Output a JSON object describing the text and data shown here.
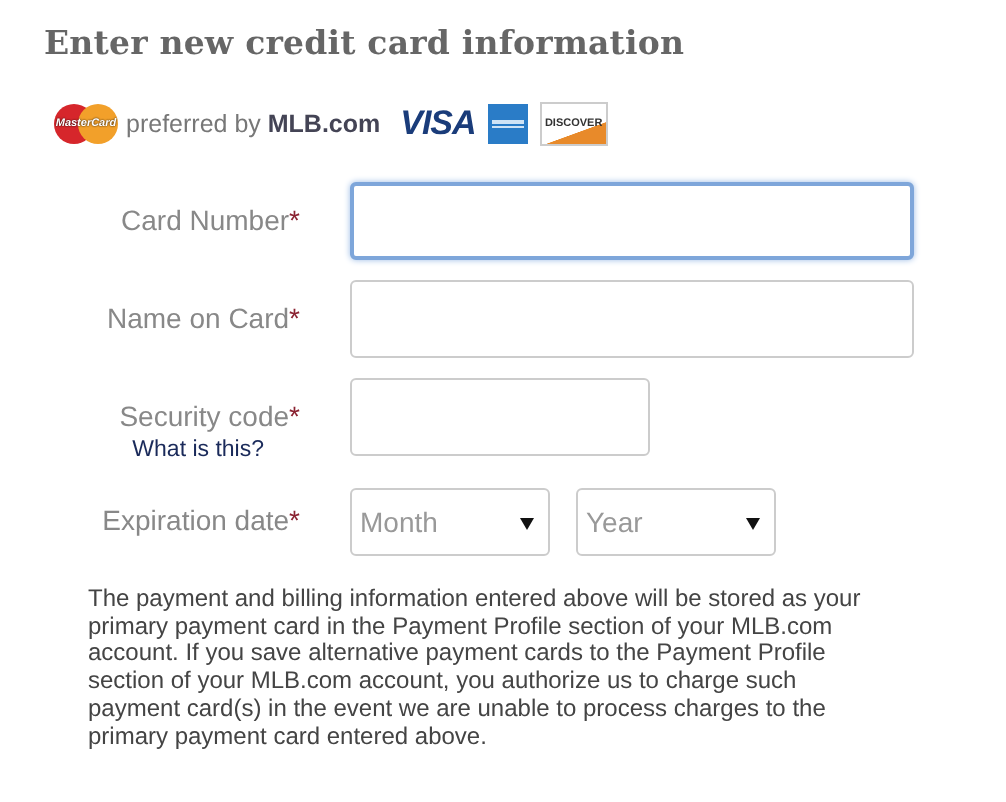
{
  "title": "Enter new credit card information",
  "card_logos": {
    "mastercard": "MasterCard",
    "preferred": "preferred by **MLB.com**",
    "visa": "VISA",
    "discover": "DISCOVER"
  },
  "fields": [
    {
      "kind": "text",
      "label": "Card Number",
      "required": "*",
      "focused": true
    },
    {
      "kind": "text",
      "label": "Name on Card",
      "required": "*",
      "focused": false
    },
    {
      "kind": "short",
      "label": "Security code",
      "required": "*",
      "help_link": "What is this?",
      "focused": false
    },
    {
      "kind": "selects",
      "label": "Expiration date",
      "required": "*",
      "selects": [
        "Month",
        "Year"
      ]
    }
  ],
  "notice": "The payment and billing information entered above will be stored as your primary payment card in the Payment Profile section of your MLB.com account. If you save alternative payment cards to the Payment Profile section of your MLB.com account, you authorize us to charge such payment card(s) in the event we are unable to process charges to the primary payment card entered above."
}
